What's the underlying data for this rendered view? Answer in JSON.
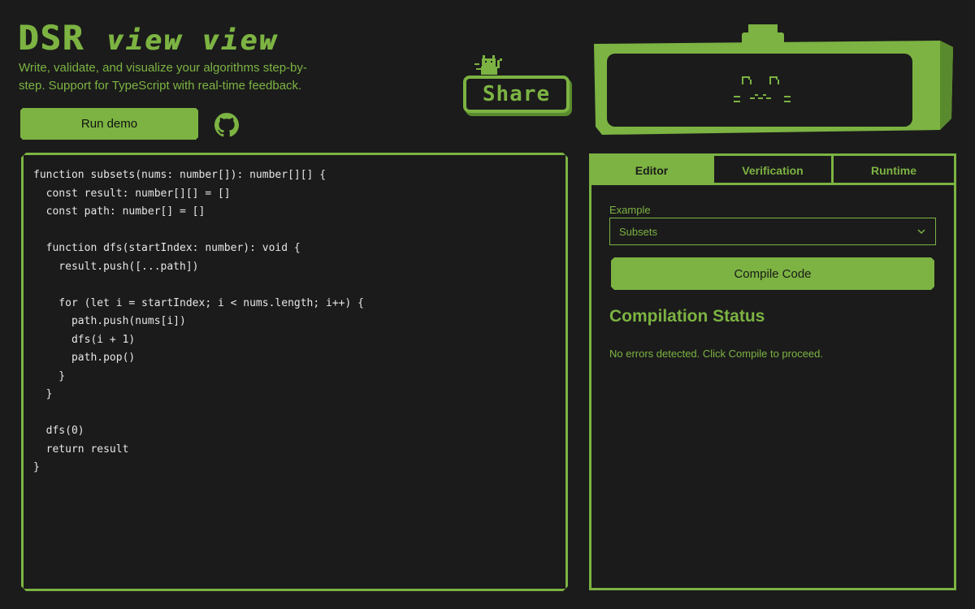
{
  "header": {
    "logo_main": "DSR",
    "logo_sub": "view view",
    "tagline": "Write, validate, and visualize your algorithms step-by-step. Support for TypeScript with real-time feedback.",
    "run_demo_label": "Run demo",
    "share_label": "Share",
    "github_icon": "github-icon"
  },
  "editor": {
    "code": "function subsets(nums: number[]): number[][] {\n  const result: number[][] = []\n  const path: number[] = []\n\n  function dfs(startIndex: number): void {\n    result.push([...path])\n\n    for (let i = startIndex; i < nums.length; i++) {\n      path.push(nums[i])\n      dfs(i + 1)\n      path.pop()\n    }\n  }\n\n  dfs(0)\n  return result\n}"
  },
  "panel": {
    "tabs": [
      {
        "label": "Editor",
        "active": true
      },
      {
        "label": "Verification",
        "active": false
      },
      {
        "label": "Runtime",
        "active": false
      }
    ],
    "example_label": "Example",
    "example_value": "Subsets",
    "compile_label": "Compile Code",
    "status_title": "Compilation Status",
    "status_text": "No errors detected. Click Compile to proceed."
  },
  "colors": {
    "accent": "#7cb342",
    "background": "#1b1b1b",
    "code_text": "#e6e6e6"
  }
}
